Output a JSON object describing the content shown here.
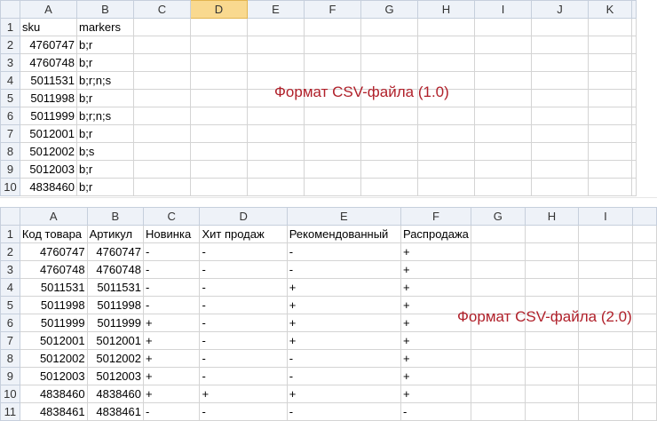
{
  "sheet1": {
    "columns": [
      "A",
      "B",
      "C",
      "D",
      "E",
      "F",
      "G",
      "H",
      "I",
      "J",
      "K"
    ],
    "selected_column": "D",
    "row_numbers": [
      "1",
      "2",
      "3",
      "4",
      "5",
      "6",
      "7",
      "8",
      "9",
      "10"
    ],
    "header": [
      "sku",
      "markers"
    ],
    "rows": [
      [
        "4760747",
        "b;r"
      ],
      [
        "4760748",
        "b;r"
      ],
      [
        "5011531",
        "b;r;n;s"
      ],
      [
        "5011998",
        "b;r"
      ],
      [
        "5011999",
        "b;r;n;s"
      ],
      [
        "5012001",
        "b;r"
      ],
      [
        "5012002",
        "b;s"
      ],
      [
        "5012003",
        "b;r"
      ],
      [
        "4838460",
        "b;r"
      ]
    ],
    "caption": "Формат CSV-файла (1.0)"
  },
  "sheet2": {
    "columns": [
      "A",
      "B",
      "C",
      "D",
      "E",
      "F",
      "G",
      "H",
      "I"
    ],
    "row_numbers": [
      "1",
      "2",
      "3",
      "4",
      "5",
      "6",
      "7",
      "8",
      "9",
      "10",
      "11"
    ],
    "header": [
      "Код товара",
      "Артикул",
      "Новинка",
      "Хит продаж",
      "Рекомендованный",
      "Распродажа"
    ],
    "rows": [
      [
        "4760747",
        "4760747",
        "-",
        "-",
        "-",
        "+"
      ],
      [
        "4760748",
        "4760748",
        "-",
        "-",
        "-",
        "+"
      ],
      [
        "5011531",
        "5011531",
        "-",
        "-",
        "+",
        "+"
      ],
      [
        "5011998",
        "5011998",
        "-",
        "-",
        "+",
        "+"
      ],
      [
        "5011999",
        "5011999",
        "+",
        "-",
        "+",
        "+"
      ],
      [
        "5012001",
        "5012001",
        "+",
        "-",
        "+",
        "+"
      ],
      [
        "5012002",
        "5012002",
        "+",
        "-",
        "-",
        "+"
      ],
      [
        "5012003",
        "5012003",
        "+",
        "-",
        "-",
        "+"
      ],
      [
        "4838460",
        "4838460",
        "+",
        "+",
        "+",
        "+"
      ],
      [
        "4838461",
        "4838461",
        "-",
        "-",
        "-",
        "-"
      ]
    ],
    "caption": "Формат CSV-файла (2.0)"
  }
}
